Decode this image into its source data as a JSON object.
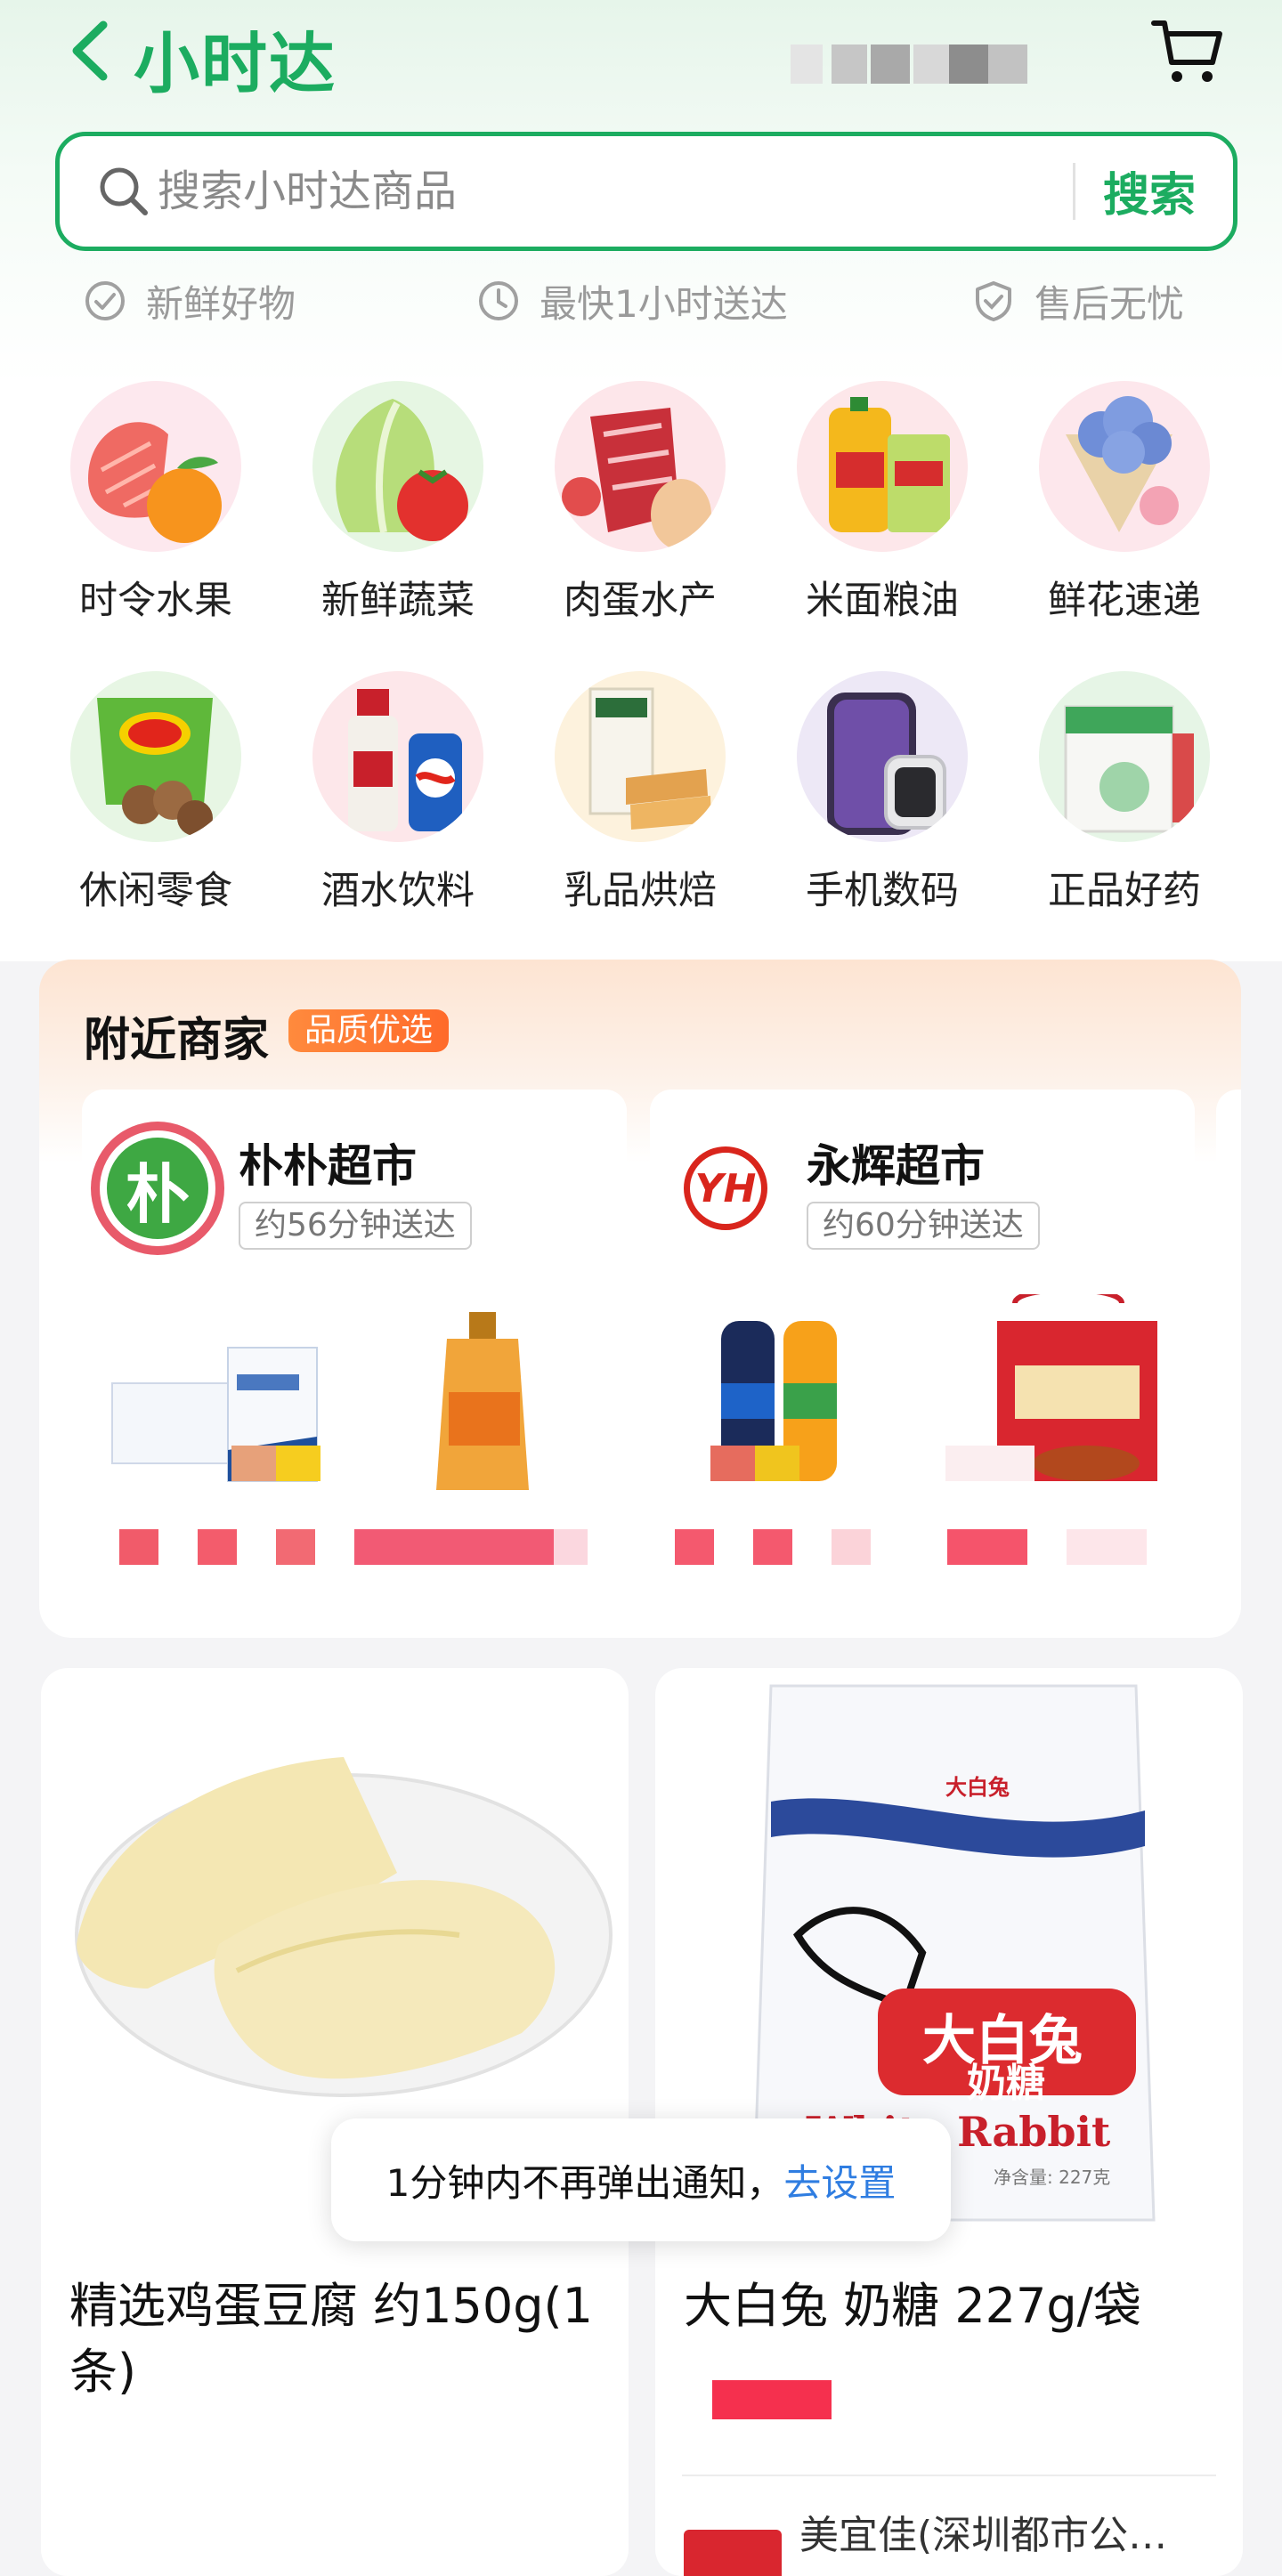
{
  "header": {
    "title": "小时达",
    "back_icon": "chevron-left-icon",
    "cart_icon": "cart-icon"
  },
  "search": {
    "placeholder": "搜索小时达商品",
    "button_label": "搜索"
  },
  "features": [
    {
      "icon": "check-circle-icon",
      "label": "新鲜好物"
    },
    {
      "icon": "clock-icon",
      "label": "最快1小时送达"
    },
    {
      "icon": "shield-check-icon",
      "label": "售后无忧"
    }
  ],
  "categories": [
    {
      "label": "时令水果",
      "icon": "fruit-icon"
    },
    {
      "label": "新鲜蔬菜",
      "icon": "vegetable-icon"
    },
    {
      "label": "肉蛋水产",
      "icon": "meat-egg-icon"
    },
    {
      "label": "米面粮油",
      "icon": "grain-oil-icon"
    },
    {
      "label": "鲜花速递",
      "icon": "flower-icon"
    },
    {
      "label": "休闲零食",
      "icon": "snack-icon"
    },
    {
      "label": "酒水饮料",
      "icon": "drink-icon"
    },
    {
      "label": "乳品烘焙",
      "icon": "dairy-bakery-icon"
    },
    {
      "label": "手机数码",
      "icon": "phone-digital-icon"
    },
    {
      "label": "正品好药",
      "icon": "medicine-icon"
    }
  ],
  "nearby": {
    "title": "附近商家",
    "badge": "品质优选",
    "stores": [
      {
        "name": "朴朴超市",
        "logo_text": "朴",
        "eta": "约56分钟送达"
      },
      {
        "name": "永辉超市",
        "logo_text": "YH",
        "eta": "约60分钟送达"
      }
    ]
  },
  "products": [
    {
      "name": "精选鸡蛋豆腐 约150g(1条)"
    },
    {
      "name": "大白兔 奶糖 227g/袋",
      "seller": "美宜佳(深圳都市公…",
      "package_title": "大白兔",
      "package_subtitle": "奶糖",
      "package_en": "White Rabbit",
      "package_weight": "净含量: 227克"
    }
  ],
  "toast": {
    "message": "1分钟内不再弹出通知，",
    "link": "去设置"
  },
  "colors": {
    "brand_green": "#1cac60",
    "orange": "#ff7a33",
    "link_blue": "#2f7de1"
  }
}
